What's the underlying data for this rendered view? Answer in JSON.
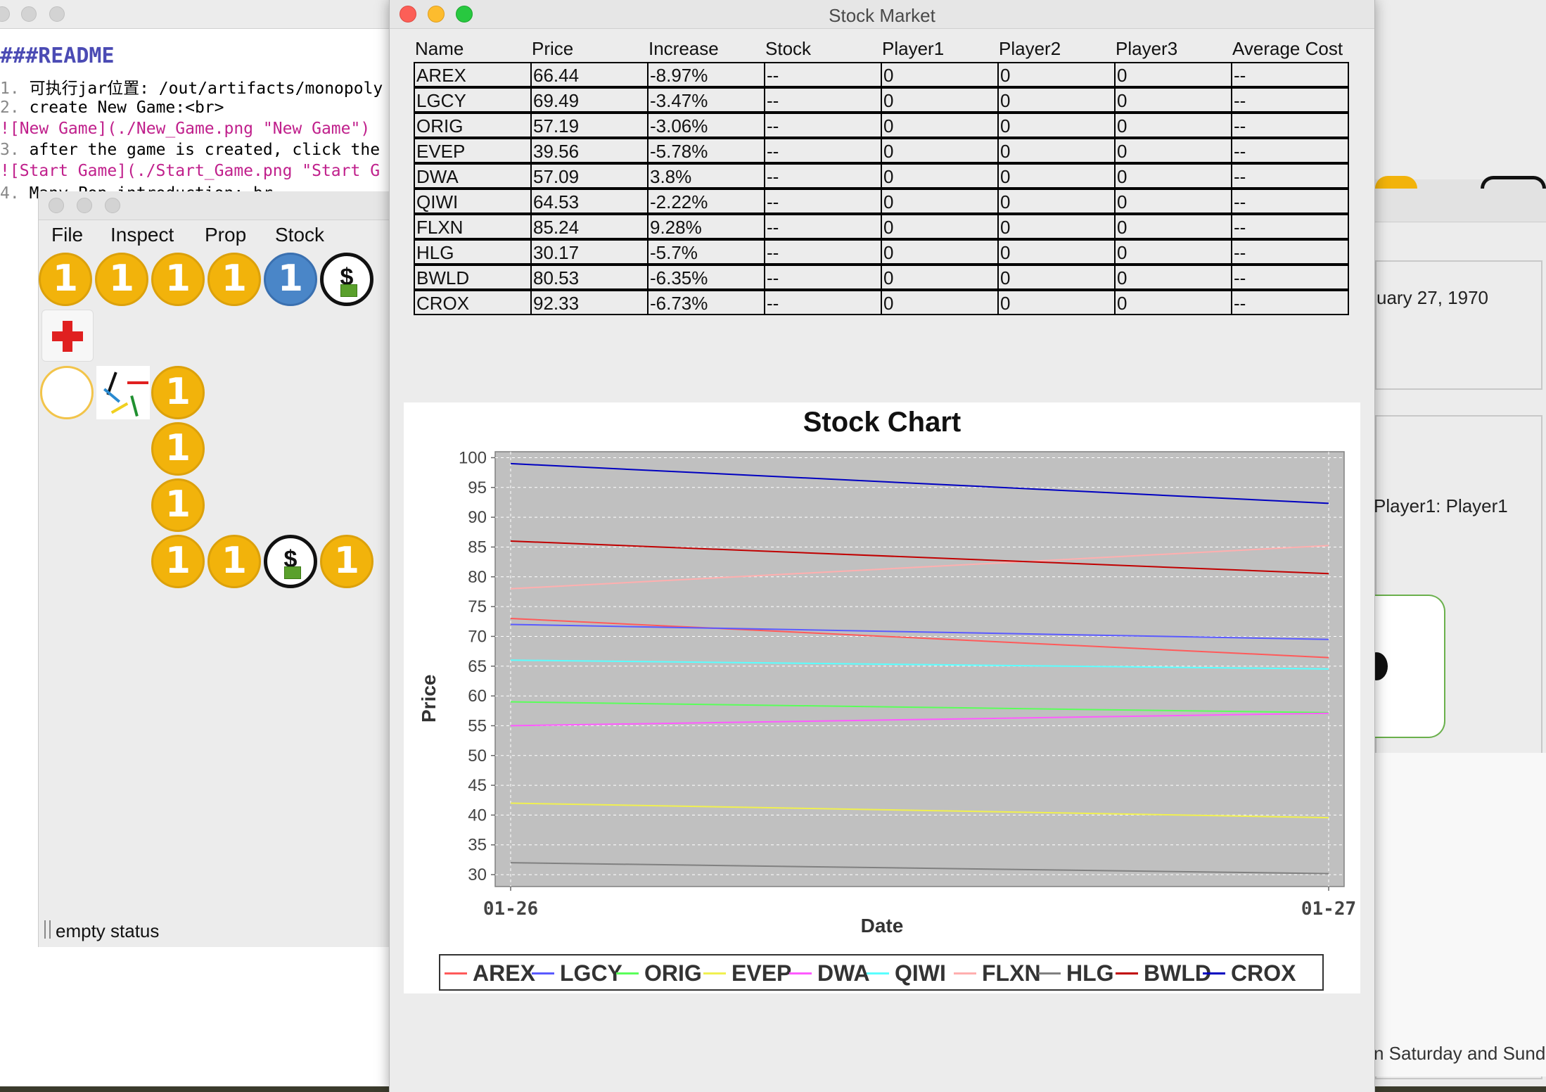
{
  "readme": {
    "heading": "###README",
    "lines": [
      {
        "num": "1.",
        "text": "可执行jar位置: /out/artifacts/monopoly"
      },
      {
        "num": "2.",
        "text": "create New Game:<br>"
      },
      {
        "num": "",
        "text": "![New Game](./New_Game.png \"New Game\")"
      },
      {
        "num": "3.",
        "text": "after the game is created, click the"
      },
      {
        "num": "",
        "text": "![Start Game](./Start_Game.png \"Start G"
      },
      {
        "num": "4.",
        "text": "Many Pop introduction: br"
      }
    ]
  },
  "board_window": {
    "menu": [
      "File",
      "Inspect",
      "Prop",
      "Stock"
    ],
    "coin_label": "1",
    "status": "empty status"
  },
  "background_window": {
    "date_text": "uary 27, 1970",
    "player_text": "Player1: Player1",
    "footer_text": "n Saturday and Sunda"
  },
  "stock_window": {
    "title": "Stock Market",
    "columns": [
      "Name",
      "Price",
      "Increase",
      "Stock",
      "Player1",
      "Player2",
      "Player3",
      "Average Cost"
    ],
    "rows": [
      [
        "AREX",
        "66.44",
        "-8.97%",
        "--",
        "0",
        "0",
        "0",
        "--"
      ],
      [
        "LGCY",
        "69.49",
        "-3.47%",
        "--",
        "0",
        "0",
        "0",
        "--"
      ],
      [
        "ORIG",
        "57.19",
        "-3.06%",
        "--",
        "0",
        "0",
        "0",
        "--"
      ],
      [
        "EVEP",
        "39.56",
        "-5.78%",
        "--",
        "0",
        "0",
        "0",
        "--"
      ],
      [
        "DWA",
        "57.09",
        "3.8%",
        "--",
        "0",
        "0",
        "0",
        "--"
      ],
      [
        "QIWI",
        "64.53",
        "-2.22%",
        "--",
        "0",
        "0",
        "0",
        "--"
      ],
      [
        "FLXN",
        "85.24",
        "9.28%",
        "--",
        "0",
        "0",
        "0",
        "--"
      ],
      [
        "HLG",
        "30.17",
        "-5.7%",
        "--",
        "0",
        "0",
        "0",
        "--"
      ],
      [
        "BWLD",
        "80.53",
        "-6.35%",
        "--",
        "0",
        "0",
        "0",
        "--"
      ],
      [
        "CROX",
        "92.33",
        "-6.73%",
        "--",
        "0",
        "0",
        "0",
        "--"
      ]
    ]
  },
  "chart_data": {
    "type": "line",
    "title": "Stock Chart",
    "xlabel": "Date",
    "ylabel": "Price",
    "x": [
      "01-26",
      "01-27"
    ],
    "ylim": [
      28,
      101
    ],
    "yticks": [
      30,
      35,
      40,
      45,
      50,
      55,
      60,
      65,
      70,
      75,
      80,
      85,
      90,
      95,
      100
    ],
    "grid": true,
    "legend_position": "bottom",
    "series": [
      {
        "name": "AREX",
        "color": "#ff5a5a",
        "values": [
          73.0,
          66.44
        ]
      },
      {
        "name": "LGCY",
        "color": "#5a5aff",
        "values": [
          72.0,
          69.49
        ]
      },
      {
        "name": "ORIG",
        "color": "#5aff5a",
        "values": [
          59.0,
          57.19
        ]
      },
      {
        "name": "EVEP",
        "color": "#f0f050",
        "values": [
          42.0,
          39.56
        ]
      },
      {
        "name": "DWA",
        "color": "#ff5aff",
        "values": [
          55.0,
          57.09
        ]
      },
      {
        "name": "QIWI",
        "color": "#5affff",
        "values": [
          66.0,
          64.53
        ]
      },
      {
        "name": "FLXN",
        "color": "#ffafaf",
        "values": [
          78.0,
          85.24
        ]
      },
      {
        "name": "HLG",
        "color": "#808080",
        "values": [
          32.0,
          30.17
        ]
      },
      {
        "name": "BWLD",
        "color": "#c00000",
        "values": [
          86.0,
          80.53
        ]
      },
      {
        "name": "CROX",
        "color": "#0000c0",
        "values": [
          99.0,
          92.33
        ]
      }
    ]
  }
}
